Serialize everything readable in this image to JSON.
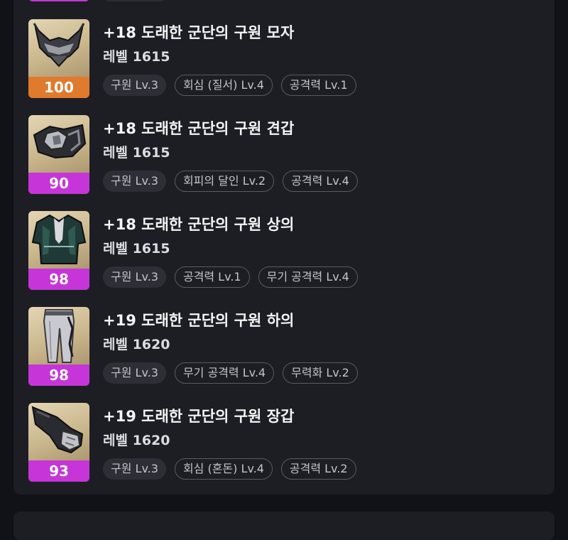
{
  "items": [
    {
      "title": "+18 도래한 군단의 구원 모자",
      "level": "레벨 1615",
      "quality": "100",
      "quality_color": "#e07a2c",
      "icon": "helmet-icon",
      "tags": [
        "구원 Lv.3",
        "회심 (질서) Lv.4",
        "공격력 Lv.1"
      ]
    },
    {
      "title": "+18 도래한 군단의 구원 견갑",
      "level": "레벨 1615",
      "quality": "90",
      "quality_color": "#c535d8",
      "icon": "shoulder-armor-icon",
      "tags": [
        "구원 Lv.3",
        "회피의 달인 Lv.2",
        "공격력 Lv.4"
      ]
    },
    {
      "title": "+18 도래한 군단의 구원 상의",
      "level": "레벨 1615",
      "quality": "98",
      "quality_color": "#c535d8",
      "icon": "chest-armor-icon",
      "tags": [
        "구원 Lv.3",
        "공격력 Lv.1",
        "무기 공격력 Lv.4"
      ]
    },
    {
      "title": "+19 도래한 군단의 구원 하의",
      "level": "레벨 1620",
      "quality": "98",
      "quality_color": "#c535d8",
      "icon": "pants-icon",
      "tags": [
        "구원 Lv.3",
        "무기 공격력 Lv.4",
        "무력화 Lv.2"
      ]
    },
    {
      "title": "+19 도래한 군단의 구원 장갑",
      "level": "레벨 1620",
      "quality": "93",
      "quality_color": "#c535d8",
      "icon": "gloves-icon",
      "tags": [
        "구원 Lv.3",
        "회심 (혼돈) Lv.4",
        "공격력 Lv.2"
      ]
    }
  ]
}
